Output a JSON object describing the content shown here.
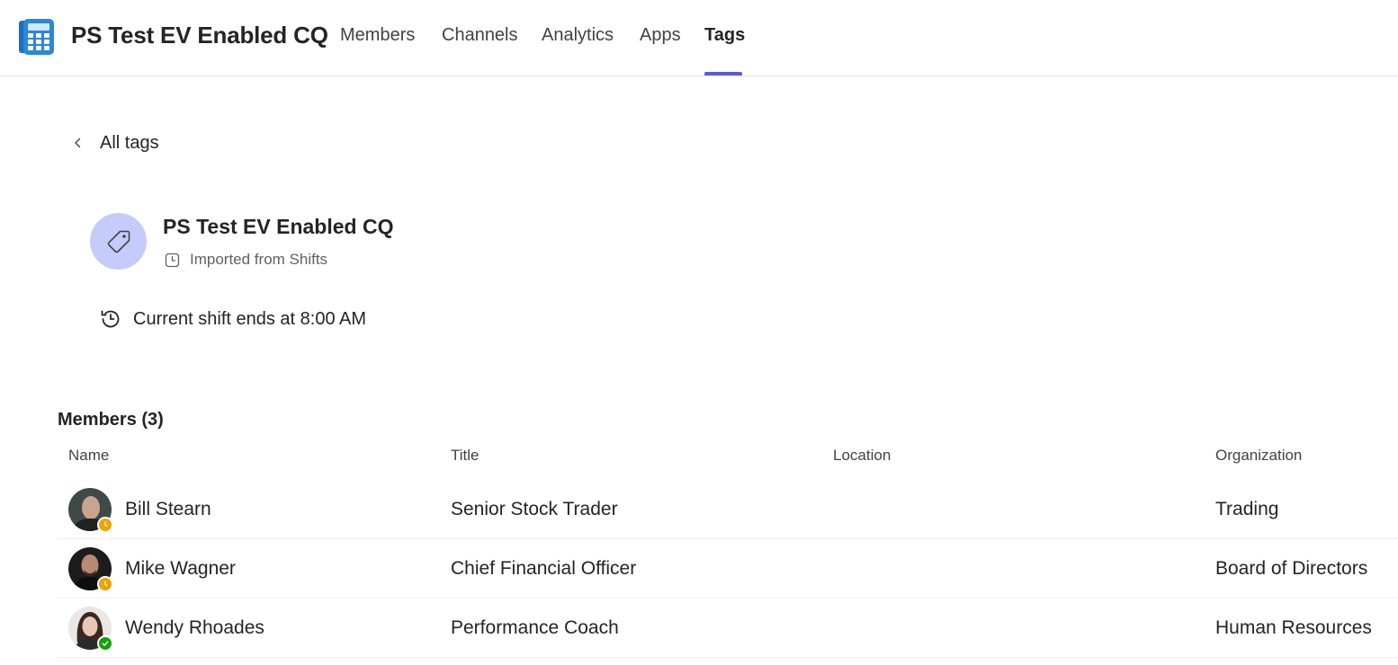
{
  "header": {
    "title": "PS Test EV Enabled CQ",
    "app_icon": "calculator-phone-icon",
    "tabs": [
      {
        "label": "Members",
        "active": false
      },
      {
        "label": "Channels",
        "active": false
      },
      {
        "label": "Analytics",
        "active": false
      },
      {
        "label": "Apps",
        "active": false
      },
      {
        "label": "Tags",
        "active": true
      }
    ],
    "accent_color": "#5b5fc7"
  },
  "back": {
    "label": "All tags",
    "icon": "chevron-left-icon"
  },
  "tag": {
    "name": "PS Test EV Enabled CQ",
    "icon": "tag-icon",
    "avatar_color": "#c5cbfa",
    "source": "Imported from Shifts",
    "source_icon": "clock-icon",
    "shift_text": "Current shift ends at 8:00 AM",
    "shift_icon": "history-icon"
  },
  "members": {
    "heading": "Members (3)",
    "columns": [
      "Name",
      "Title",
      "Location",
      "Organization"
    ],
    "rows": [
      {
        "name": "Bill Stearn",
        "title": "Senior Stock Trader",
        "location": "",
        "organization": "Trading",
        "presence": "away",
        "presence_color": "#eaa300"
      },
      {
        "name": "Mike Wagner",
        "title": "Chief Financial Officer",
        "location": "",
        "organization": "Board of Directors",
        "presence": "away",
        "presence_color": "#eaa300"
      },
      {
        "name": "Wendy Rhoades",
        "title": "Performance Coach",
        "location": "",
        "organization": "Human Resources",
        "presence": "available",
        "presence_color": "#13a10e"
      }
    ]
  }
}
